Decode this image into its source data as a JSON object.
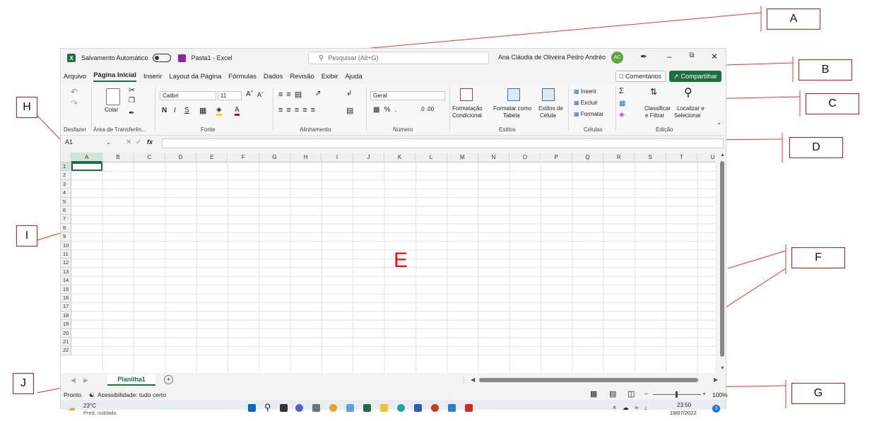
{
  "titlebar": {
    "logo": "X",
    "autosave_label": "Salvamento Automático",
    "doc_title": "Pasta1 - Excel",
    "search_placeholder": "Pesquisar (Alt+G)",
    "user_name": "Ana Cláudia de Oliveira Pedro Andréo",
    "avatar_initials": "AC",
    "icons": [
      "excel-logo-icon",
      "autosave-toggle",
      "save-icon",
      "search-icon",
      "pen-icon",
      "minimize-icon",
      "restore-icon",
      "close-icon"
    ]
  },
  "menu": {
    "items": [
      "Arquivo",
      "Página Inicial",
      "Inserir",
      "Layout da Página",
      "Fórmulas",
      "Dados",
      "Revisão",
      "Exibir",
      "Ajuda"
    ],
    "comments_label": "Comentários",
    "share_label": "Compartilhar"
  },
  "ribbon": {
    "undo_group": "Desfazer",
    "clipboard_group": "Área de Transferên...",
    "paste_label": "Colar",
    "font_name": "Calibri",
    "font_size": "11",
    "font_group": "Fonte",
    "align_group": "Alinhamento",
    "number_format": "Geral",
    "number_group": "Número",
    "cond_format": "Formatação",
    "cond_format2": "Condicional",
    "format_table": "Formatar como",
    "format_table2": "Tabela",
    "cell_styles": "Estilos de",
    "cell_styles2": "Célula",
    "styles_group": "Estilos",
    "insert": "Inserir",
    "delete": "Excluir",
    "format": "Formatar",
    "cells_group": "Células",
    "sort": "Classificar",
    "sort2": "e Filtrar",
    "find": "Localizar e",
    "find2": "Selecionar",
    "edit_group": "Edição"
  },
  "formula_bar": {
    "name_box": "A1",
    "fx": "fx"
  },
  "grid": {
    "columns": [
      "A",
      "B",
      "C",
      "D",
      "E",
      "F",
      "G",
      "H",
      "I",
      "J",
      "K",
      "L",
      "M",
      "N",
      "O",
      "P",
      "Q",
      "R",
      "S",
      "T",
      "U"
    ],
    "rows": [
      "1",
      "2",
      "3",
      "4",
      "5",
      "6",
      "7",
      "8",
      "9",
      "10",
      "11",
      "12",
      "13",
      "14",
      "15",
      "16",
      "17",
      "18",
      "19",
      "20",
      "21",
      "22"
    ],
    "selected_cell": "A1"
  },
  "sheets": {
    "active": "Planilha1",
    "add": "+"
  },
  "status": {
    "ready": "Pronto",
    "accessibility": "Acessibilidade: tudo certo",
    "zoom": "100%"
  },
  "taskbar": {
    "temp": "23°C",
    "weather": "Pred. nublado",
    "time": "23:50",
    "date": "19/07/2022",
    "notif": "3"
  },
  "callouts": {
    "A": "A",
    "B": "B",
    "C": "C",
    "D": "D",
    "E": "E",
    "F": "F",
    "G": "G",
    "H": "H",
    "I": "I",
    "J": "J"
  },
  "colors": {
    "excel_green": "#1d6f42",
    "callout_red": "#dd1111"
  }
}
